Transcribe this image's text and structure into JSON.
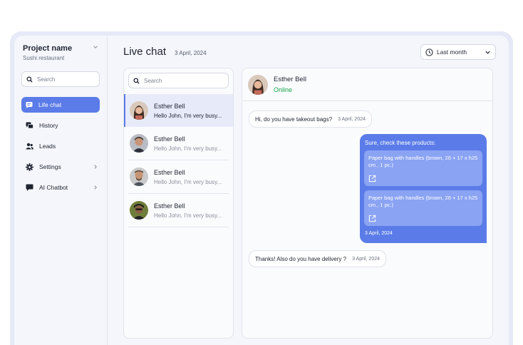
{
  "project": {
    "name": "Project name",
    "subtitle": "Sushi restaurant"
  },
  "sidebar": {
    "search_placeholder": "Search",
    "items": [
      {
        "label": "Life chat",
        "icon": "chat-icon",
        "active": true
      },
      {
        "label": "History",
        "icon": "history-icon"
      },
      {
        "label": "Leads",
        "icon": "leads-icon"
      },
      {
        "label": "Settings",
        "icon": "gear-icon"
      },
      {
        "label": "AI Chatbot",
        "icon": "chatbot-icon"
      }
    ]
  },
  "header": {
    "title": "Live chat",
    "date": "3 April, 2024",
    "period": "Last month"
  },
  "contacts": {
    "search_placeholder": "Search",
    "list": [
      {
        "name": "Esther Bell",
        "preview": "Hello John, I'm very busy..."
      },
      {
        "name": "Esther Bell",
        "preview": "Hello John, I'm very busy..."
      },
      {
        "name": "Esther Bell",
        "preview": "Hello John, I'm very busy..."
      },
      {
        "name": "Esther Bell",
        "preview": "Hello John, I'm very busy..."
      }
    ]
  },
  "chat": {
    "name": "Esther Bell",
    "status": "Online",
    "messages": {
      "m1": {
        "text": "Hi, do you have takeout bags?",
        "time": "3 April, 2024"
      },
      "reply": {
        "title": "Sure, check these products:",
        "products": [
          "Paper bag with handles (brown, 26 + 17 x h25 cm., 1 pc.)",
          "Paper bag with handles (brown, 26 + 17 x h25 cm., 1 pc.)"
        ],
        "time": "3 April, 2024"
      },
      "m2": {
        "text": "Thanks! Also do you have delivery ?",
        "time": "3 April, 2024"
      }
    }
  },
  "colors": {
    "accent": "#5b7ce8",
    "online": "#1aa34a"
  }
}
